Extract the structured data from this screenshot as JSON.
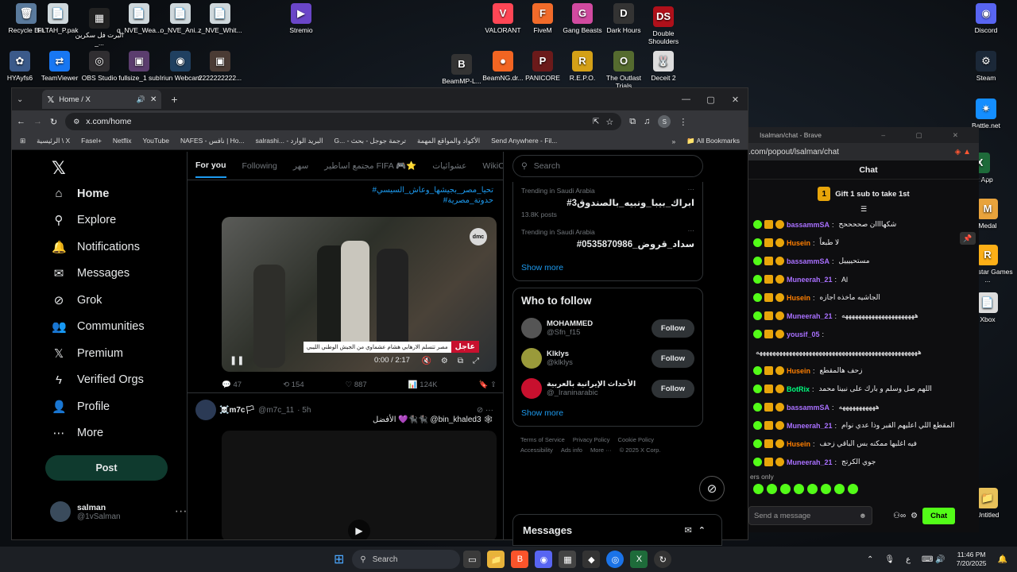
{
  "desktop_icons": [
    {
      "label": "Recycle Bin",
      "glyph": "🗑",
      "color": "#5a7a9c"
    },
    {
      "label": "FLTAH_P.pak",
      "glyph": "📄",
      "color": "#cfd8dc"
    },
    {
      "label": "البرت فل سكرين _...",
      "glyph": "▦",
      "color": "#222"
    },
    {
      "label": "q_NVE_Wea...",
      "glyph": "📄",
      "color": "#cfd8dc"
    },
    {
      "label": "o_NVE_Ani...",
      "glyph": "📄",
      "color": "#cfd8dc"
    },
    {
      "label": "z_NVE_Whit...",
      "glyph": "📄",
      "color": "#cfd8dc"
    },
    {
      "label": "Stremio",
      "glyph": "▶",
      "color": "#6a46c8"
    },
    {
      "label": "VALORANT",
      "glyph": "V",
      "color": "#ff4655"
    },
    {
      "label": "FiveM",
      "glyph": "F",
      "color": "#f26b2a"
    },
    {
      "label": "Gang Beasts",
      "glyph": "G",
      "color": "#d14aa0"
    },
    {
      "label": "Dark Hours",
      "glyph": "D",
      "color": "#333"
    },
    {
      "label": "Double Shoulders",
      "glyph": "DS",
      "color": "#b0101a"
    },
    {
      "label": "Discord",
      "glyph": "◉",
      "color": "#5865f2"
    },
    {
      "label": "HYAyfs6",
      "glyph": "✿",
      "color": "#3b5a8a"
    },
    {
      "label": "TeamViewer",
      "glyph": "⇄",
      "color": "#1877f2"
    },
    {
      "label": "OBS Studio",
      "glyph": "◎",
      "color": "#302e31"
    },
    {
      "label": "fullsize_1 sub",
      "glyph": "▣",
      "color": "#5b3d6e"
    },
    {
      "label": "Iriun Webcam",
      "glyph": "◉",
      "color": "#204060"
    },
    {
      "label": "2222222222...",
      "glyph": "▣",
      "color": "#4a3b34"
    },
    {
      "label": "BeamMP-L...",
      "glyph": "B",
      "color": "#333"
    },
    {
      "label": "BeamNG.dr...",
      "glyph": "●",
      "color": "#f26522"
    },
    {
      "label": "PANICORE",
      "glyph": "P",
      "color": "#6b1a1a"
    },
    {
      "label": "R.E.P.O.",
      "glyph": "R",
      "color": "#d4a017"
    },
    {
      "label": "The Outlast Trials",
      "glyph": "O",
      "color": "#556b2f"
    },
    {
      "label": "Deceit 2",
      "glyph": "🐰",
      "color": "#ddd"
    },
    {
      "label": "Steam",
      "glyph": "⚙",
      "color": "#1b2838"
    },
    {
      "label": "Battle.net",
      "glyph": "✷",
      "color": "#148eff"
    },
    {
      "label": "XLR App",
      "glyph": "X",
      "color": "#1e6b3a"
    },
    {
      "label": "Medal",
      "glyph": "M",
      "color": "#e8a33c"
    },
    {
      "label": "Rockstar Games ...",
      "glyph": "R",
      "color": "#fcaf17"
    },
    {
      "label": "Xbox",
      "glyph": "📄",
      "color": "#ddd"
    },
    {
      "label": "Untitled",
      "glyph": "📁",
      "color": "#e8c15a"
    }
  ],
  "browser": {
    "tab_title": "Home / X",
    "url": "x.com/home",
    "new_tab": "+",
    "bookmarks": [
      "الرئيسية \\ X",
      "Fasel+",
      "Netflix",
      "YouTube",
      "NAFES - نافس | Ho...",
      "salrashi... - البريد الوارد",
      "G... - ترجمة جوجل - بحث",
      "الأكواد والمواقع المهمة",
      "Send Anywhere - Fil..."
    ],
    "all_bookmarks": "All Bookmarks",
    "profile_initial": "S"
  },
  "x": {
    "nav": [
      {
        "label": "Home",
        "icon": "home-icon",
        "glyph": "⌂"
      },
      {
        "label": "Explore",
        "icon": "search-icon",
        "glyph": "⚲"
      },
      {
        "label": "Notifications",
        "icon": "bell-icon",
        "glyph": "🔔"
      },
      {
        "label": "Messages",
        "icon": "mail-icon",
        "glyph": "✉"
      },
      {
        "label": "Grok",
        "icon": "grok-icon",
        "glyph": "⊘"
      },
      {
        "label": "Communities",
        "icon": "people-icon",
        "glyph": "👥"
      },
      {
        "label": "Premium",
        "icon": "x-icon",
        "glyph": "𝕏"
      },
      {
        "label": "Verified Orgs",
        "icon": "bolt-icon",
        "glyph": "ϟ"
      },
      {
        "label": "Profile",
        "icon": "person-icon",
        "glyph": "👤"
      },
      {
        "label": "More",
        "icon": "more-circle-icon",
        "glyph": "⋯"
      }
    ],
    "post_button": "Post",
    "account": {
      "name": "salman",
      "handle": "@1vSalman"
    },
    "feed_tabs": [
      "For you",
      "Following",
      "سهر",
      "مجتمع اساطير FIFA 🎮⭐",
      "عشوائيات",
      "WikiCo"
    ],
    "post1": {
      "hashtags": [
        "#تحيا_مصر_بجيشها_وعاش_السيسي",
        "#حدوتة_مصرية"
      ],
      "video_caption_tag": "عاجل",
      "video_caption": "مصر تتسلم الارهابي هشام عشماوي من الجيش الوطني الليبي",
      "video_channel": "dmc",
      "time": "0:00 / 2:17",
      "replies": "47",
      "reposts": "154",
      "likes": "887",
      "views": "124K"
    },
    "post2": {
      "name": "☠️m7c🏳",
      "handle": "@m7c_11",
      "time": "· 5h",
      "text": "الأفضل 💜🐈‍⬛🐈‍⬛ @bin_khaled3 🕸"
    },
    "search_placeholder": "Search",
    "trends": [
      {
        "context": "Trending in Saudi Arabia",
        "name": "#ابراك_بيبا_ونبيه_بالصندوق3",
        "count": "13.8K posts"
      },
      {
        "context": "Trending in Saudi Arabia",
        "name": "#سداد_قروض_0535870986",
        "count": ""
      }
    ],
    "show_more": "Show more",
    "who_to_follow_title": "Who to follow",
    "who_to_follow": [
      {
        "name": "MOHAMMED",
        "handle": "@Sfn_f15",
        "color": "#555"
      },
      {
        "name": "Klklys",
        "handle": "@klklys",
        "color": "#9a9a3a"
      },
      {
        "name": "الأحداث الإيرانية بالعربية",
        "handle": "@_Iraninarabic",
        "color": "#c8102e"
      }
    ],
    "follow_label": "Follow",
    "footer": [
      "Terms of Service",
      "Privacy Policy",
      "Cookie Policy",
      "Accessibility",
      "Ads info",
      "More ···",
      "© 2025 X Corp."
    ],
    "messages_label": "Messages"
  },
  "popout": {
    "title": "Isalman/chat - Brave",
    "url": ".com/popout/lsalman/chat",
    "header": "Chat",
    "gift_text": "Gift 1 sub to take 1st",
    "gift_count": "1",
    "messages": [
      {
        "user": "bassammSA",
        "color": "#a970ff",
        "text": "شكهاااان صححححح"
      },
      {
        "user": "Husein",
        "color": "#ff7f00",
        "text": "لا طبعاً"
      },
      {
        "user": "bassammSA",
        "color": "#a970ff",
        "text": "مستحييييل"
      },
      {
        "user": "Muneerah_21",
        "color": "#a970ff",
        "text": "Al"
      },
      {
        "user": "Husein",
        "color": "#ff7f00",
        "text": "الجاشيه ماخذه اجازه"
      },
      {
        "user": "Muneerah_21",
        "color": "#a970ff",
        "text": "ههههههههههههههههههههههه"
      },
      {
        "user": "yousif_05",
        "color": "#a970ff",
        "text": ""
      },
      {
        "user": "",
        "color": "#efeff1",
        "text": "هههههههههههههههههههههههههههههههههههههههههههههههههه"
      },
      {
        "user": "Husein",
        "color": "#ff7f00",
        "text": "زحف هالمقطع"
      },
      {
        "user": "BotRix",
        "color": "#00ff7f",
        "text": "اللهم صل وسلم و بارك على نبينا محمد"
      },
      {
        "user": "bassammSA",
        "color": "#a970ff",
        "text": "هههههههههههه"
      },
      {
        "user": "Muneerah_21",
        "color": "#a970ff",
        "text": "المقطع اللي اعليهم القبر وذا عدي نوام"
      },
      {
        "user": "Husein",
        "color": "#ff7f00",
        "text": "فيه اغلبها ممكنه بس الباقي زحف"
      },
      {
        "user": "Muneerah_21",
        "color": "#a970ff",
        "text": "جوي الكرتج"
      }
    ],
    "followers_only": "ers only",
    "input_placeholder": "Send a message",
    "chat_button": "Chat"
  },
  "taskbar": {
    "search_placeholder": "Search",
    "time": "11:46 PM",
    "date": "7/20/2025",
    "lang": "ع"
  },
  "colors": {
    "x_accent": "#1d9bf0",
    "kick_green": "#53fc18",
    "chat_btn": "#53fc18"
  }
}
